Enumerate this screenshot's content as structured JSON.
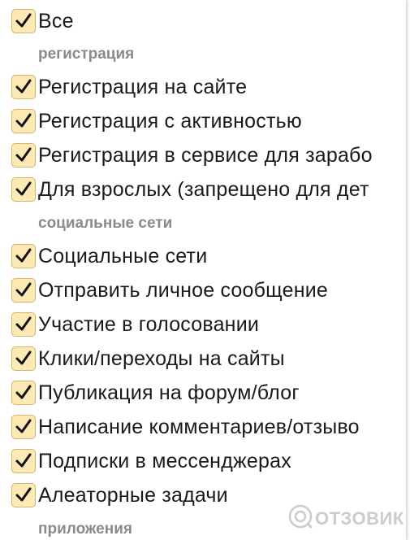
{
  "items": {
    "all": "Все",
    "section_registration": "регистрация",
    "reg_site": "Регистрация на сайте",
    "reg_activity": "Регистрация с активностью",
    "reg_service": "Регистрация в сервисе для зарабо",
    "adults": "Для взрослых (запрещено для дет",
    "section_social": "социальные сети",
    "social": "Социальные сети",
    "send_message": "Отправить личное сообщение",
    "voting": "Участие в голосовании",
    "clicks": "Клики/переходы на сайты",
    "forum": "Публикация на форум/блог",
    "comments": "Написание комментариев/отзыво",
    "messengers": "Подписки в мессенджерах",
    "random": "Алеаторные задачи",
    "section_apps": "приложения"
  },
  "watermark": {
    "text": "ОТЗОВИК",
    "icon": "otzovik-logo-icon"
  },
  "colors": {
    "checkbox_fill": "#fde9b3",
    "checkbox_border": "#d2b46a",
    "section_text": "#8a8a8a"
  }
}
